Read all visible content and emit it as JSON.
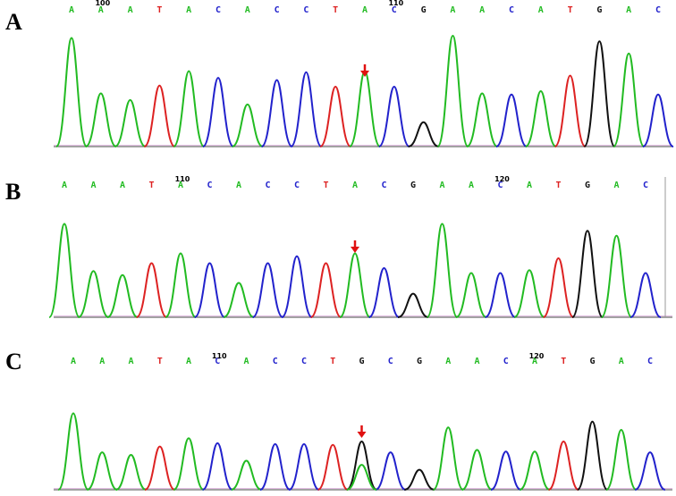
{
  "colors": {
    "A": "#22bb22",
    "C": "#2222cc",
    "T": "#dd2222",
    "G": "#111111",
    "arrow": "#e01010"
  },
  "panels": [
    {
      "label": "A",
      "position_labels": [
        "100",
        "110"
      ],
      "bases": [
        "A",
        "A",
        "A",
        "T",
        "A",
        "C",
        "A",
        "C",
        "C",
        "T",
        "A",
        "C",
        "G",
        "A",
        "A",
        "C",
        "A",
        "T",
        "G",
        "A",
        "C"
      ],
      "peak_bases": [
        "A",
        "A",
        "A",
        "T",
        "A",
        "C",
        "A",
        "C",
        "C",
        "T",
        "A",
        "C",
        "G",
        "A",
        "A",
        "C",
        "A",
        "T",
        "G",
        "A",
        "C"
      ],
      "peak_heights": [
        0.98,
        0.48,
        0.42,
        0.55,
        0.68,
        0.62,
        0.38,
        0.6,
        0.67,
        0.54,
        0.68,
        0.54,
        0.22,
        1.0,
        0.48,
        0.47,
        0.5,
        0.64,
        0.95,
        0.84,
        0.47
      ],
      "arrow_index": 10
    },
    {
      "label": "B",
      "position_labels": [
        "110",
        "120"
      ],
      "bases": [
        "A",
        "A",
        "A",
        "T",
        "A",
        "C",
        "A",
        "C",
        "C",
        "T",
        "A",
        "C",
        "G",
        "A",
        "A",
        "C",
        "A",
        "T",
        "G",
        "A",
        "C"
      ],
      "peak_bases": [
        "A",
        "A",
        "A",
        "T",
        "A",
        "C",
        "A",
        "C",
        "C",
        "T",
        "A",
        "C",
        "G",
        "A",
        "A",
        "C",
        "A",
        "T",
        "G",
        "A",
        "C"
      ],
      "peak_heights": [
        0.95,
        0.47,
        0.43,
        0.55,
        0.65,
        0.55,
        0.35,
        0.55,
        0.62,
        0.55,
        0.65,
        0.5,
        0.24,
        0.95,
        0.45,
        0.45,
        0.48,
        0.6,
        0.88,
        0.83,
        0.45
      ],
      "arrow_index": 10
    },
    {
      "label": "C",
      "position_labels": [
        "110",
        "120"
      ],
      "bases": [
        "A",
        "A",
        "A",
        "T",
        "A",
        "C",
        "A",
        "C",
        "C",
        "T",
        "G",
        "C",
        "G",
        "A",
        "A",
        "C",
        "A",
        "T",
        "G",
        "A",
        "C"
      ],
      "peak_bases": [
        "A",
        "A",
        "A",
        "T",
        "A",
        "C",
        "A",
        "C",
        "C",
        "T",
        "G",
        "C",
        "G",
        "A",
        "A",
        "C",
        "A",
        "T",
        "G",
        "A",
        "C"
      ],
      "peak_heights": [
        0.92,
        0.45,
        0.42,
        0.52,
        0.62,
        0.56,
        0.35,
        0.55,
        0.55,
        0.54,
        0.58,
        0.45,
        0.24,
        0.75,
        0.48,
        0.46,
        0.46,
        0.58,
        0.82,
        0.72,
        0.45
      ],
      "secondary_peak": {
        "index": 10,
        "base": "A",
        "height": 0.3
      },
      "arrow_index": 10
    }
  ]
}
